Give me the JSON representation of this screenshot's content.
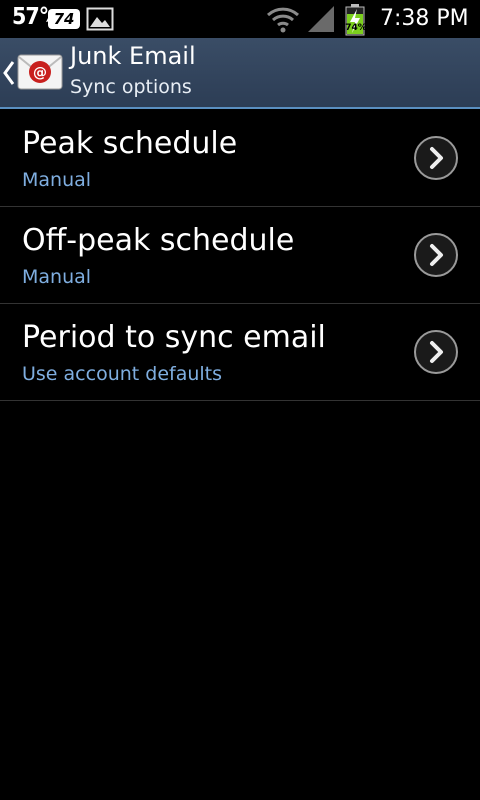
{
  "status_bar": {
    "temperature": "57°",
    "badge": "74",
    "battery_percent": "74%",
    "time": "7:38 PM",
    "icons": [
      "image-icon",
      "wifi-icon",
      "signal-icon",
      "battery-charging-icon"
    ]
  },
  "action_bar": {
    "title": "Junk Email",
    "subtitle": "Sync options",
    "icon": "email-app-icon"
  },
  "settings": [
    {
      "title": "Peak schedule",
      "value": "Manual"
    },
    {
      "title": "Off-peak schedule",
      "value": "Manual"
    },
    {
      "title": "Period to sync email",
      "value": "Use account defaults"
    }
  ],
  "colors": {
    "action_bar": "#34475f",
    "value_text": "#7faee0",
    "divider": "#333333",
    "battery_green": "#7ccf1e"
  }
}
